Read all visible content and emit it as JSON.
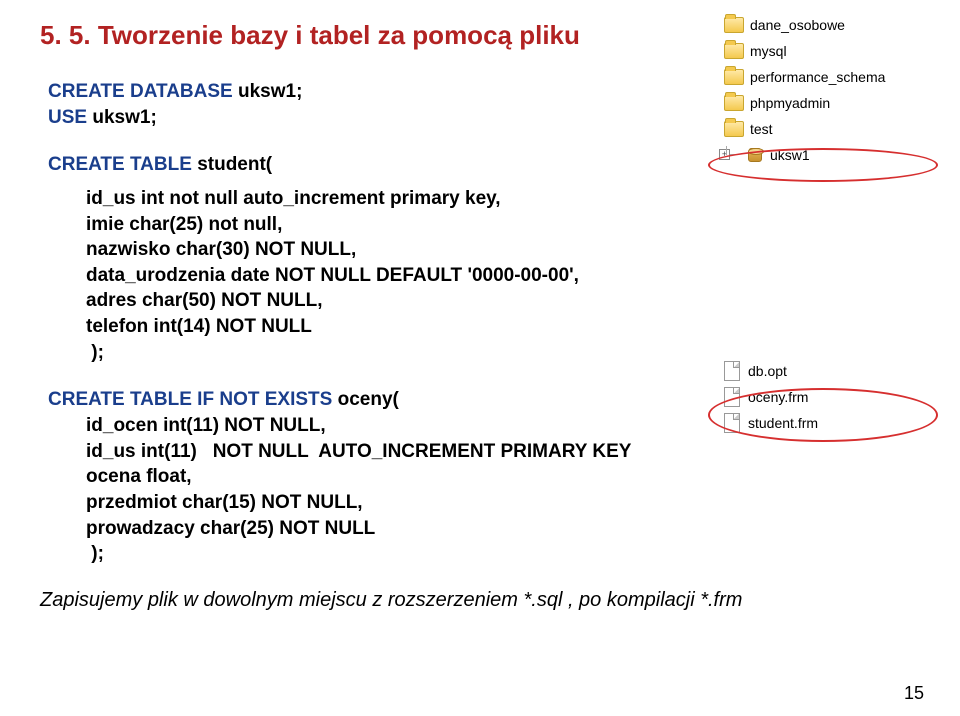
{
  "title": "5. 5. Tworzenie bazy i tabel za pomocą pliku",
  "code1": {
    "l1a": "CREATE DATABASE ",
    "l1b": "uksw1;",
    "l2a": "USE ",
    "l2b": "uksw1;"
  },
  "code2": {
    "l1a": "CREATE TABLE ",
    "l1b": "student(",
    "p1": "id_us int not null auto_increment primary key,",
    "p2": "imie char(25) not null,",
    "p3": "nazwisko char(30) NOT NULL,",
    "p4": "data_urodzenia date NOT NULL DEFAULT '0000-00-00',",
    "p5": "adres char(50) NOT NULL,",
    "p6": "telefon int(14) NOT NULL",
    "close": " );"
  },
  "code3": {
    "l1a": "CREATE TABLE IF NOT EXISTS ",
    "l1b": "oceny(",
    "p1": "id_ocen int(11) NOT NULL,",
    "p2": "id_us int(11)   NOT NULL  AUTO_INCREMENT PRIMARY KEY",
    "p3": "ocena float,",
    "p4": "przedmiot char(15) NOT NULL,",
    "p5": "prowadzacy char(25) NOT NULL",
    "close": " );"
  },
  "footer": "Zapisujemy plik w dowolnym miejscu z rozszerzeniem *.sql , po kompilacji *.frm",
  "page_num": "15",
  "folders": {
    "f1": "dane_osobowe",
    "f2": "mysql",
    "f3": "performance_schema",
    "f4": "phpmyadmin",
    "f5": "test",
    "f6": "uksw1"
  },
  "files": {
    "x1": "db.opt",
    "x2": "oceny.frm",
    "x3": "student.frm"
  },
  "plus": "+"
}
